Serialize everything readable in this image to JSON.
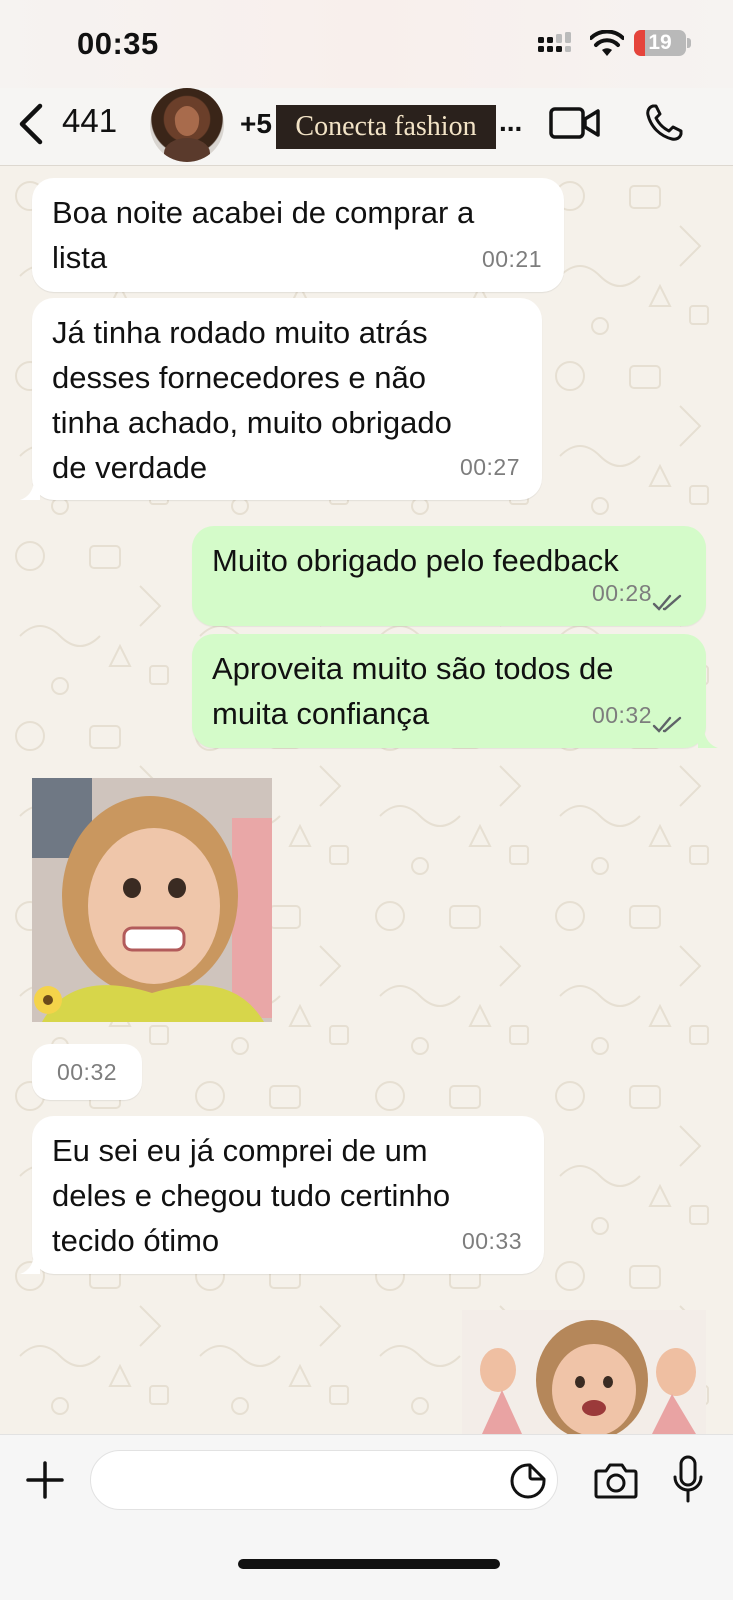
{
  "status_bar": {
    "time": "00:35",
    "battery_percent": "19",
    "icons": [
      "signal-icon",
      "wifi-icon",
      "battery-icon"
    ]
  },
  "header": {
    "unread_count": "441",
    "contact_prefix": "+5",
    "contact_name": "Conecta fashion",
    "ellipsis": "...",
    "icons": [
      "back-icon",
      "avatar",
      "video-call-icon",
      "voice-call-icon"
    ]
  },
  "messages": [
    {
      "direction": "in",
      "text": "Boa noite acabei de comprar a\nlista",
      "time": "00:21"
    },
    {
      "direction": "in",
      "text": "Já tinha rodado muito atrás\ndesses fornecedores e não\ntinha achado, muito obrigado\nde verdade",
      "time": "00:27"
    },
    {
      "direction": "out",
      "text": "Muito obrigado pelo feedback",
      "time": "00:28",
      "status": "read"
    },
    {
      "direction": "out",
      "text": "Aproveita muito são todos de\nmuita confiança",
      "time": "00:32",
      "status": "read"
    },
    {
      "direction": "in",
      "type": "sticker",
      "time": "00:32"
    },
    {
      "direction": "in",
      "text": "Eu sei eu já comprei de um\ndeles e chegou tudo certinho\ntecido ótimo",
      "time": "00:33"
    },
    {
      "direction": "out",
      "type": "sticker"
    }
  ],
  "composer": {
    "placeholder": "",
    "icons": [
      "plus-icon",
      "sticker-icon",
      "camera-icon",
      "microphone-icon"
    ]
  },
  "colors": {
    "incoming_bubble": "#ffffff",
    "outgoing_bubble": "#d4fbc9",
    "wallpaper": "#f5f1ea",
    "read_ticks": "#5f6368"
  }
}
